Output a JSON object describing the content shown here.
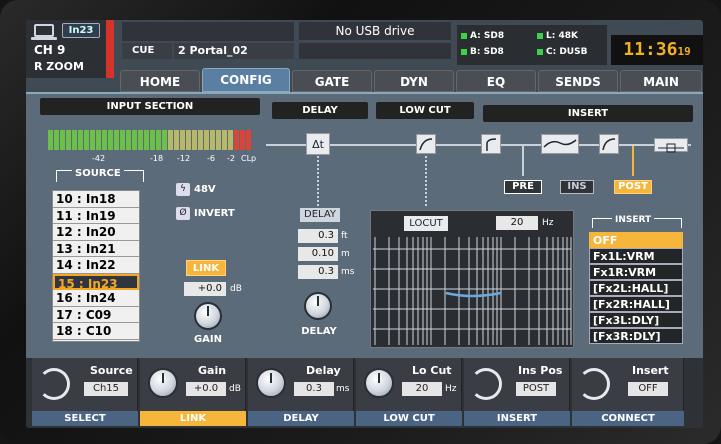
{
  "header": {
    "channel": "CH 9",
    "channel_tag": "In23",
    "zoom": "R ZOOM",
    "cue_label": "CUE",
    "cue_name": "2 Portal_02",
    "usb_status": "No USB drive",
    "status": {
      "a": "A: SD8",
      "b": "B: SD8",
      "l": "L: 48K",
      "c": "C: DUSB"
    },
    "clock_hm": "11:36",
    "clock_s": "19"
  },
  "tabs": [
    "HOME",
    "CONFIG",
    "GATE",
    "DYN",
    "EQ",
    "SENDS",
    "MAIN"
  ],
  "active_tab": "CONFIG",
  "input": {
    "title": "INPUT SECTION",
    "meter_ticks": [
      "-42",
      "-18",
      "-12",
      "-6",
      "-2",
      "CLp"
    ],
    "source_label": "SOURCE",
    "sources": [
      "10 : In18",
      "11 : In19",
      "12 : In20",
      "13 : In21",
      "14 : In22",
      "15 : In23",
      "16 : In24",
      "17 : C09",
      "18 : C10"
    ],
    "selected_source": "15 : In23",
    "phantom": "48V",
    "invert": "INVERT",
    "link": "LINK",
    "gain_value": "+0.0",
    "gain_unit": "dB",
    "gain_label": "GAIN"
  },
  "delay": {
    "title": "DELAY",
    "icon_label": "Δt",
    "label": "DELAY",
    "ft": "0.3",
    "m": "0.10",
    "ms": "0.3",
    "u_ft": "ft",
    "u_m": "m",
    "u_ms": "ms",
    "knob_label": "DELAY"
  },
  "lowcut": {
    "title": "LOW CUT",
    "locut_label": "LOCUT",
    "freq": "20",
    "unit": "Hz"
  },
  "insert": {
    "title": "INSERT",
    "pos": [
      "PRE",
      "INS",
      "POST"
    ],
    "selected_pos": "POST",
    "list_label": "INSERT",
    "items": [
      "OFF",
      "Fx1L:VRM",
      "Fx1R:VRM",
      "[Fx2L:HALL]",
      "[Fx2R:HALL]",
      "[Fx3L:DLY]",
      "[Fx3R:DLY]"
    ],
    "selected_item": "OFF"
  },
  "bottom": [
    {
      "title": "Source",
      "value": "Ch15",
      "unit": "",
      "foot": "SELECT"
    },
    {
      "title": "Gain",
      "value": "+0.0",
      "unit": "dB",
      "foot": "LINK"
    },
    {
      "title": "Delay",
      "value": "0.3",
      "unit": "ms",
      "foot": "DELAY"
    },
    {
      "title": "Lo Cut",
      "value": "20",
      "unit": "Hz",
      "foot": "LOW CUT"
    },
    {
      "title": "Ins Pos",
      "value": "POST",
      "unit": "",
      "foot": "INSERT"
    },
    {
      "title": "Insert",
      "value": "OFF",
      "unit": "",
      "foot": "CONNECT"
    }
  ],
  "colors": {
    "accent": "#f5b63b",
    "tab_active": "#5b7ea3",
    "clock": "#f0b020"
  }
}
